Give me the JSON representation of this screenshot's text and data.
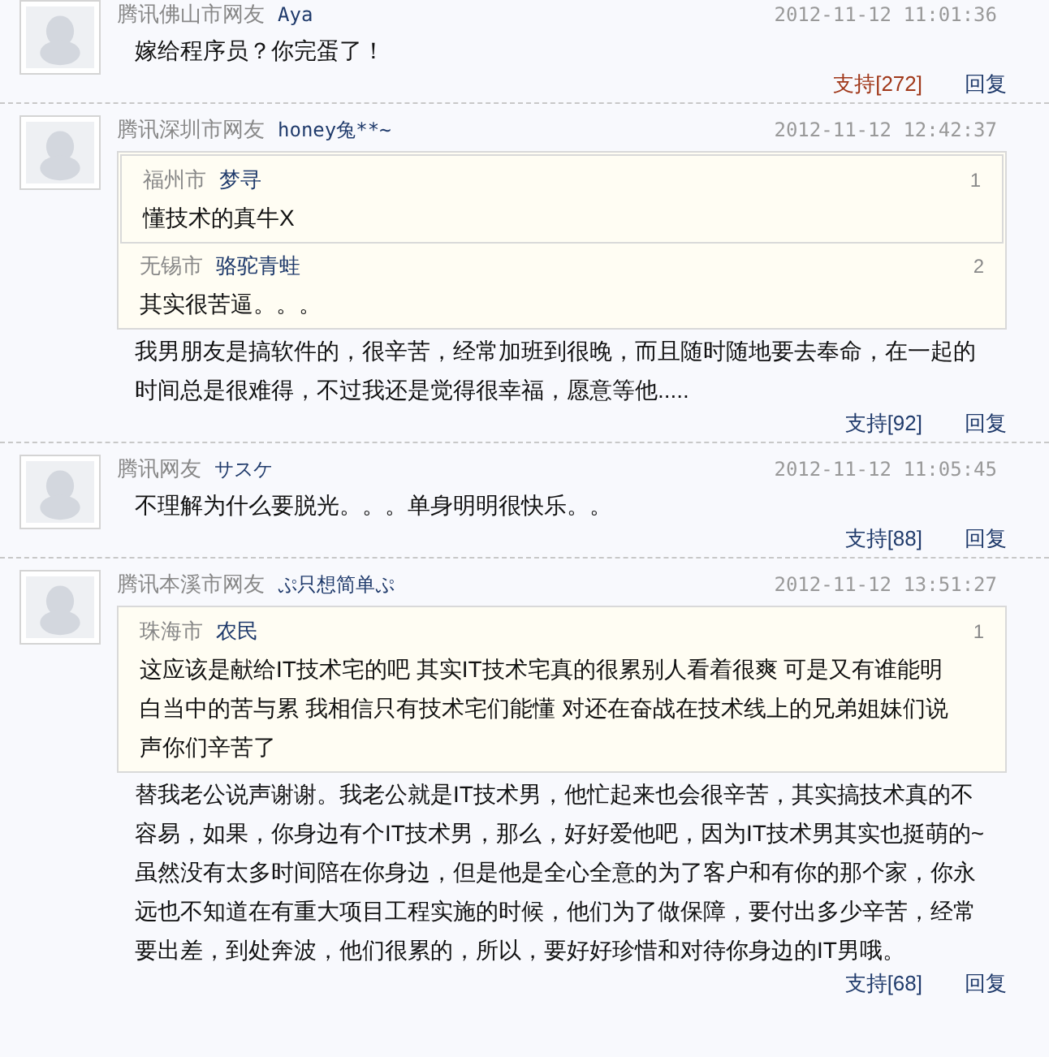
{
  "comments": [
    {
      "source": "腾讯佛山市网友",
      "user": "Aya",
      "time": "2012-11-12 11:01:36",
      "text": "嫁给程序员？你完蛋了！",
      "support": "支持[272]",
      "support_highlighted": true,
      "reply": "回复"
    },
    {
      "source": "腾讯深圳市网友",
      "user": "honey兔**~",
      "time": "2012-11-12 12:42:37",
      "quote": {
        "city": "无锡市",
        "user": "骆驼青蛙",
        "floor": "2",
        "text": "其实很苦逼。。。",
        "quote": {
          "city": "福州市",
          "user": "梦寻",
          "floor": "1",
          "text": "懂技术的真牛X"
        }
      },
      "text": "我男朋友是搞软件的，很辛苦，经常加班到很晚，而且随时随地要去奉命，在一起的时间总是很难得，不过我还是觉得很幸福，愿意等他.....",
      "support": "支持[92]",
      "support_highlighted": false,
      "reply": "回复"
    },
    {
      "source": "腾讯网友",
      "user": "サスケ",
      "time": "2012-11-12 11:05:45",
      "text": "不理解为什么要脱光。。。单身明明很快乐。。",
      "support": "支持[88]",
      "support_highlighted": false,
      "reply": "回复"
    },
    {
      "source": "腾讯本溪市网友",
      "user": "ぷ只想简单ぷ",
      "time": "2012-11-12 13:51:27",
      "quote": {
        "city": "珠海市",
        "user": "农民",
        "floor": "1",
        "text": "这应该是献给IT技术宅的吧 其实IT技术宅真的很累别人看着很爽 可是又有谁能明白当中的苦与累 我相信只有技术宅们能懂 对还在奋战在技术线上的兄弟姐妹们说声你们辛苦了"
      },
      "text": "替我老公说声谢谢。我老公就是IT技术男，他忙起来也会很辛苦，其实搞技术真的不容易，如果，你身边有个IT技术男，那么，好好爱他吧，因为IT技术男其实也挺萌的~虽然没有太多时间陪在你身边，但是他是全心全意的为了客户和有你的那个家，你永远也不知道在有重大项目工程实施的时候，他们为了做保障，要付出多少辛苦，经常要出差，到处奔波，他们很累的，所以，要好好珍惜和对待你身边的IT男哦。",
      "support": "支持[68]",
      "support_highlighted": false,
      "reply": "回复"
    }
  ]
}
